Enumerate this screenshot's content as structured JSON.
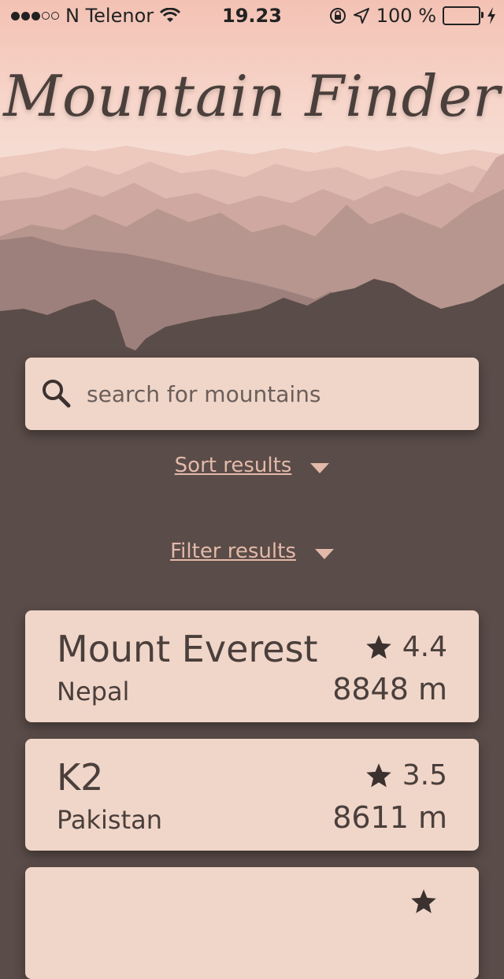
{
  "status_bar": {
    "carrier": "N Telenor",
    "time": "19.23",
    "battery": "100 %",
    "battery_level": 1.0,
    "signal_bars_filled": 3,
    "signal_bars_total": 5,
    "icons": [
      "wifi-icon",
      "rotation-lock-icon",
      "location-arrow-icon",
      "battery-icon",
      "charging-bolt-icon"
    ]
  },
  "app": {
    "title": "Mountain Finder"
  },
  "search": {
    "placeholder": "search for mountains",
    "icon": "search-icon"
  },
  "controls": {
    "sort_label": "Sort results",
    "filter_label": "Filter results"
  },
  "results": [
    {
      "name": "Mount Everest",
      "country": "Nepal",
      "rating": "4.4",
      "height": "8848 m"
    },
    {
      "name": "K2",
      "country": "Pakistan",
      "rating": "3.5",
      "height": "8611 m"
    },
    {
      "name": "",
      "country": "",
      "rating": "",
      "height": ""
    }
  ],
  "colors": {
    "background": "#5a4c48",
    "card": "#f0d5c9",
    "link": "#e3b9aa",
    "text": "#4a3f3b",
    "header_top": "#f3c2b4"
  }
}
